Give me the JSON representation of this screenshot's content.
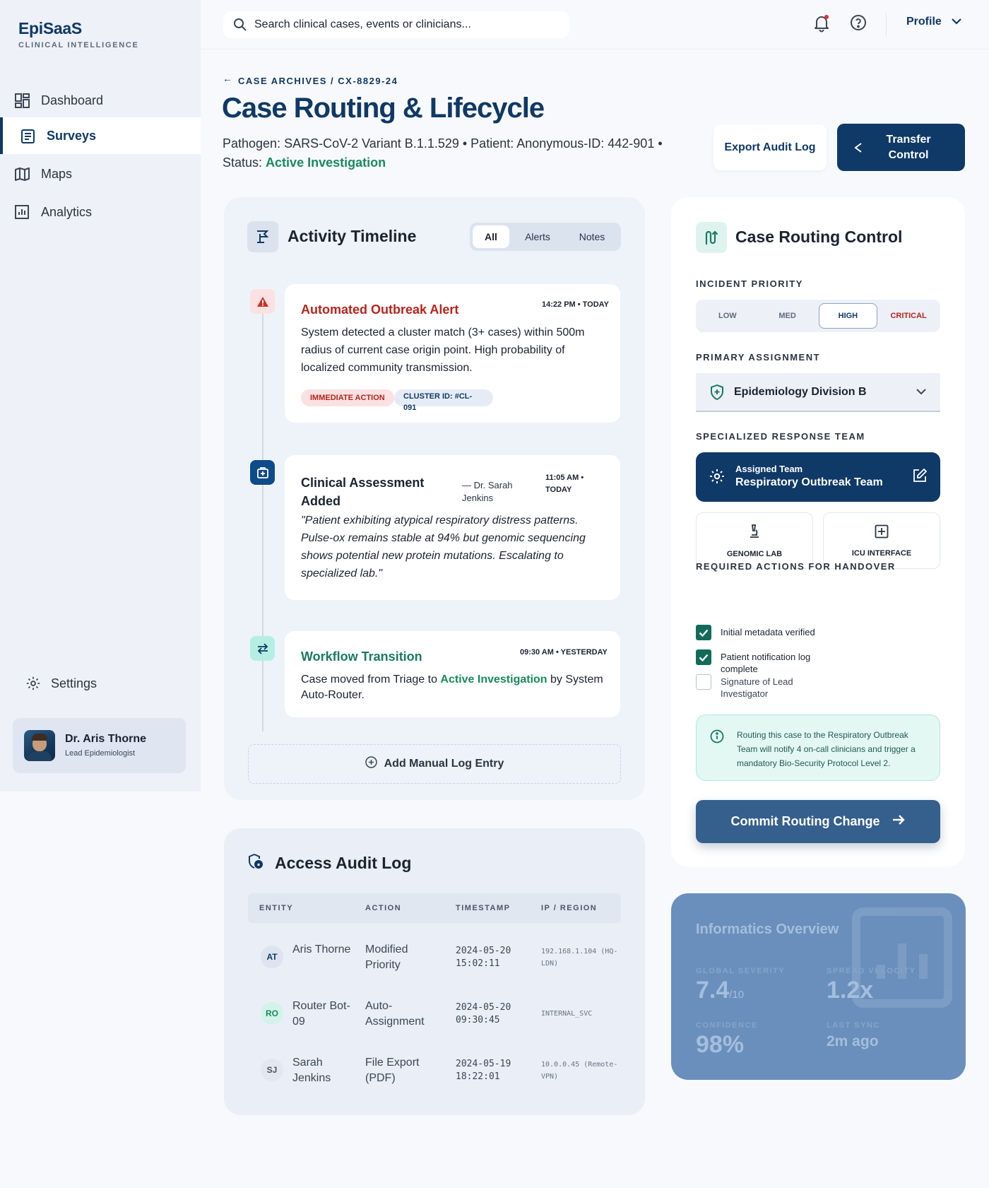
{
  "brand": {
    "name": "EpiSaaS",
    "tagline": "CLINICAL INTELLIGENCE"
  },
  "nav": [
    {
      "label": "Dashboard",
      "icon": "dashboard-icon"
    },
    {
      "label": "Surveys",
      "icon": "clipboard-icon",
      "active": true
    },
    {
      "label": "Maps",
      "icon": "map-icon"
    },
    {
      "label": "Analytics",
      "icon": "chart-icon"
    }
  ],
  "settings_label": "Settings",
  "user": {
    "name": "Dr. Aris Thorne",
    "role": "Lead Epidemiologist"
  },
  "search": {
    "placeholder": "Search clinical cases, events or clinicians..."
  },
  "profile_label": "Profile",
  "breadcrumb": "CASE ARCHIVES / CX-8829-24",
  "page": {
    "title": "Case Routing & Lifecycle",
    "meta": "Pathogen: SARS-CoV-2 Variant B.1.1.529 • Patient: Anonymous-ID: 442-901 •",
    "status_label": "Status:",
    "status_value": "Active Investigation",
    "export_label": "Export Audit Log",
    "transfer_label": "Transfer Control"
  },
  "timeline": {
    "title": "Activity Timeline",
    "tabs": [
      "All",
      "Alerts",
      "Notes"
    ],
    "events": [
      {
        "title": "Automated Outbreak Alert",
        "time": "14:22 PM • TODAY",
        "body": "System detected a cluster match (3+ cases) within 500m radius of current case origin point. High probability of localized community transmission.",
        "tags": [
          "IMMEDIATE ACTION",
          "CLUSTER ID: #CL-091"
        ]
      },
      {
        "title": "Clinical Assessment Added",
        "author": "— Dr. Sarah Jenkins",
        "time": "11:05 AM • TODAY",
        "body": "\"Patient exhibiting atypical respiratory distress patterns. Pulse-ox remains stable at 94% but genomic sequencing shows potential new protein mutations. Escalating to specialized lab.\""
      },
      {
        "title": "Workflow Transition",
        "time": "09:30 AM • YESTERDAY",
        "body_pre": "Case moved from Triage to ",
        "body_hl": "Active Investigation",
        "body_post": " by System Auto-Router."
      }
    ],
    "add_label": "Add Manual Log Entry"
  },
  "audit": {
    "title": "Access Audit Log",
    "columns": [
      "ENTITY",
      "ACTION",
      "TIMESTAMP",
      "IP / REGION"
    ],
    "rows": [
      {
        "initials": "AT",
        "entity": "Aris Thorne",
        "action": "Modified Priority",
        "timestamp": "2024-05-20 15:02:11",
        "ip": "192.168.1.104 (HQ-LDN)"
      },
      {
        "initials": "RO",
        "entity": "Router Bot-09",
        "action": "Auto-Assignment",
        "timestamp": "2024-05-20 09:30:45",
        "ip": "INTERNAL_SVC"
      },
      {
        "initials": "SJ",
        "entity": "Sarah Jenkins",
        "action": "File Export (PDF)",
        "timestamp": "2024-05-19 18:22:01",
        "ip": "10.0.0.45 (Remote-VPN)"
      }
    ]
  },
  "routing": {
    "title": "Case Routing Control",
    "priority_label": "INCIDENT PRIORITY",
    "priorities": [
      "LOW",
      "MED",
      "HIGH",
      "CRITICAL"
    ],
    "priority_selected": "HIGH",
    "assignment_label": "PRIMARY ASSIGNMENT",
    "assignment_value": "Epidemiology Division B",
    "team_label": "SPECIALIZED RESPONSE TEAM",
    "assigned_team_caption": "Assigned Team",
    "assigned_team_name": "Respiratory Outbreak Team",
    "sub_teams": [
      "GENOMIC LAB",
      "ICU INTERFACE"
    ],
    "handover_label": "REQUIRED ACTIONS FOR HANDOVER",
    "actions": [
      {
        "label": "Initial metadata verified",
        "checked": true
      },
      {
        "label": "Patient notification log complete",
        "checked": true
      },
      {
        "label": "Signature of Lead Investigator",
        "checked": false
      }
    ],
    "notice": "Routing this case to the Respiratory Outbreak Team will notify 4 on-call clinicians and trigger a mandatory Bio-Security Protocol Level 2.",
    "commit_label": "Commit Routing Change"
  },
  "informatics": {
    "title": "Informatics Overview",
    "global_severity_label": "GLOBAL SEVERITY",
    "global_severity_value": "7.4",
    "global_severity_unit": "/10",
    "spread_velocity_label": "SPREAD VELOCITY",
    "spread_velocity_value": "1.2x",
    "confidence_label": "CONFIDENCE",
    "confidence_value": "98%",
    "last_sync_label": "LAST SYNC",
    "last_sync_value": "2m ago"
  },
  "colors": {
    "primary": "#0f3966",
    "accent_green": "#1a8a5e",
    "alert_red": "#b5251d",
    "teal": "#126b5a"
  }
}
